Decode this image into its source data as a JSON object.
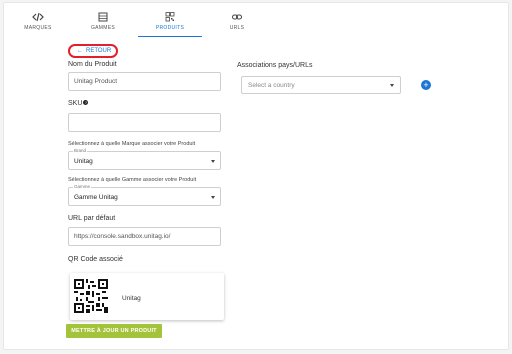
{
  "nav": {
    "tabs": [
      {
        "label": "MARQUES",
        "icon": "code-icon"
      },
      {
        "label": "GAMMES",
        "icon": "list-icon"
      },
      {
        "label": "PRODUITS",
        "icon": "qrcode-icon"
      },
      {
        "label": "URLS",
        "icon": "link-icon"
      }
    ],
    "active_index": 2,
    "accent_color": "#1976d2"
  },
  "back_label": "RETOUR",
  "form": {
    "name_label": "Nom du Produit",
    "name_value": "Unitag Product",
    "sku_label": "SKU",
    "sku_help_icon": "question-circle-icon",
    "sku_value": "",
    "brand_help": "Sélectionnez à quelle Marque associer votre Produit",
    "brand_float_label": "Brand",
    "brand_value": "Unitag",
    "range_help": "Sélectionnez à quelle Gamme associer votre Produit",
    "range_float_label": "Gamme",
    "range_value": "Gamme Unitag",
    "url_label": "URL par défaut",
    "url_value": "https://console.sandbox.unitag.io/",
    "qr_label": "QR Code associé",
    "qr_name": "Unitag",
    "submit_label": "METTRE À JOUR UN PRODUIT",
    "submit_color": "#a3c43a"
  },
  "associations": {
    "title": "Associations pays/URLs",
    "country_placeholder": "Select a country",
    "add_icon": "plus-circle-icon"
  }
}
